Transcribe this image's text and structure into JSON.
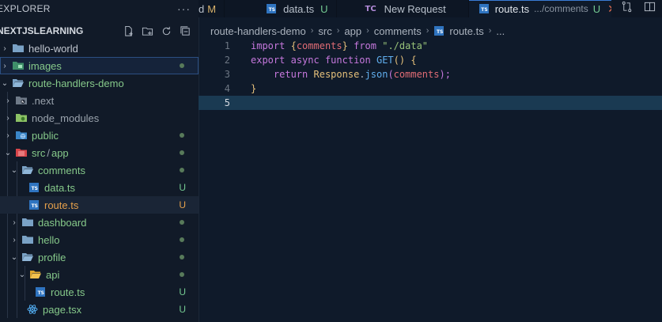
{
  "sidebar": {
    "header_title": "EXPLORER",
    "header_more": "···",
    "section_name": "NEXTJSLEARNING",
    "actions": [
      "new-file-icon",
      "new-folder-icon",
      "refresh-icon",
      "collapse-all-icon"
    ],
    "items": [
      {
        "label": "hello-world",
        "status": ""
      },
      {
        "label": "images",
        "status": "dot"
      },
      {
        "label": "route-handlers-demo",
        "status": ""
      },
      {
        "label": ".next",
        "status": ""
      },
      {
        "label": "node_modules",
        "status": ""
      },
      {
        "label": "public",
        "status": "dot"
      },
      {
        "label": "src",
        "label2": "app",
        "status": "dot"
      },
      {
        "label": "comments",
        "status": "dot"
      },
      {
        "label": "data.ts",
        "status": "U"
      },
      {
        "label": "route.ts",
        "status": "U"
      },
      {
        "label": "dashboard",
        "status": "dot"
      },
      {
        "label": "hello",
        "status": "dot"
      },
      {
        "label": "profile",
        "status": "dot"
      },
      {
        "label": "api",
        "status": "dot"
      },
      {
        "label": "route.ts",
        "status": "U"
      },
      {
        "label": "page.tsx",
        "status": "U"
      }
    ]
  },
  "tabs": [
    {
      "label": "d",
      "status": "M"
    },
    {
      "label": "data.ts",
      "status": "U"
    },
    {
      "label": "New Request",
      "badge": "TC"
    },
    {
      "label": "route.ts",
      "path": ".../comments",
      "status": "U"
    }
  ],
  "breadcrumb": [
    "route-handlers-demo",
    "src",
    "app",
    "comments",
    "route.ts",
    "..."
  ],
  "editor": {
    "line_numbers": [
      "1",
      "2",
      "3",
      "4",
      "5"
    ],
    "line1": {
      "kw1": "import",
      "b1": "{",
      "v": "comments",
      "b2": "}",
      "kw2": "from",
      "s": "\"./data\""
    },
    "line2": {
      "kw1": "export",
      "kw2": "async",
      "kw3": "function",
      "fn": "GET",
      "p": "()",
      "b": "{"
    },
    "line3": {
      "kw": "return",
      "cls": "Response",
      "dot": ".",
      "fn": "json",
      "p1": "(",
      "v": "comments",
      "p2": ");"
    },
    "line4": {
      "b": "}"
    }
  },
  "colors": {
    "accent": "#3a7bd5",
    "untracked": "#73c991",
    "modified_orange": "#e5a04b"
  }
}
